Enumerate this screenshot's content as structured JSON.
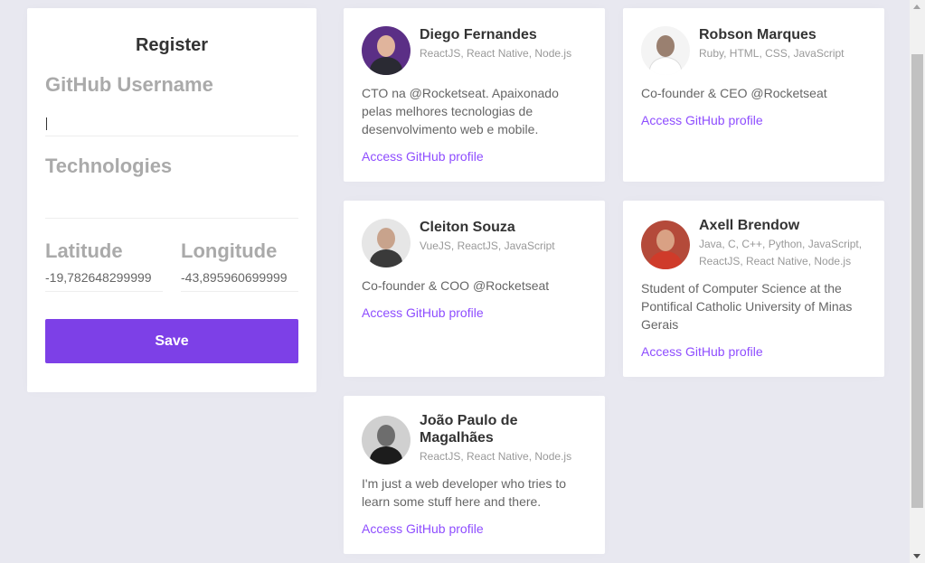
{
  "register": {
    "title": "Register",
    "github_label": "GitHub Username",
    "github_value": "",
    "techs_label": "Technologies",
    "techs_value": "",
    "latitude_label": "Latitude",
    "latitude_value": "-19,782648299999",
    "longitude_label": "Longitude",
    "longitude_value": "-43,895960699999",
    "save_label": "Save"
  },
  "devs": [
    {
      "name": "Diego Fernandes",
      "techs": "ReactJS, React Native, Node.js",
      "bio": "CTO na @Rocketseat. Apaixonado pelas melhores tecnologias de desenvolvimento web e mobile.",
      "link": "Access GitHub profile"
    },
    {
      "name": "Robson Marques",
      "techs": "Ruby, HTML, CSS, JavaScript",
      "bio": "Co-founder & CEO @Rocketseat",
      "link": "Access GitHub profile"
    },
    {
      "name": "Cleiton Souza",
      "techs": "VueJS, ReactJS, JavaScript",
      "bio": "Co-founder & COO @Rocketseat",
      "link": "Access GitHub profile"
    },
    {
      "name": "Axell Brendow",
      "techs": "Java, C, C++, Python, JavaScript, ReactJS, React Native, Node.js",
      "bio": "Student of Computer Science at the Pontifical Catholic University of Minas Gerais",
      "link": "Access GitHub profile"
    },
    {
      "name": "João Paulo de Magalhães",
      "techs": "ReactJS, React Native, Node.js",
      "bio": "I'm just a web developer who tries to learn some stuff here and there.",
      "link": "Access GitHub profile"
    }
  ],
  "colors": {
    "background": "#e8e8f0",
    "primary": "#7d40e7",
    "link": "#8e4dff"
  }
}
